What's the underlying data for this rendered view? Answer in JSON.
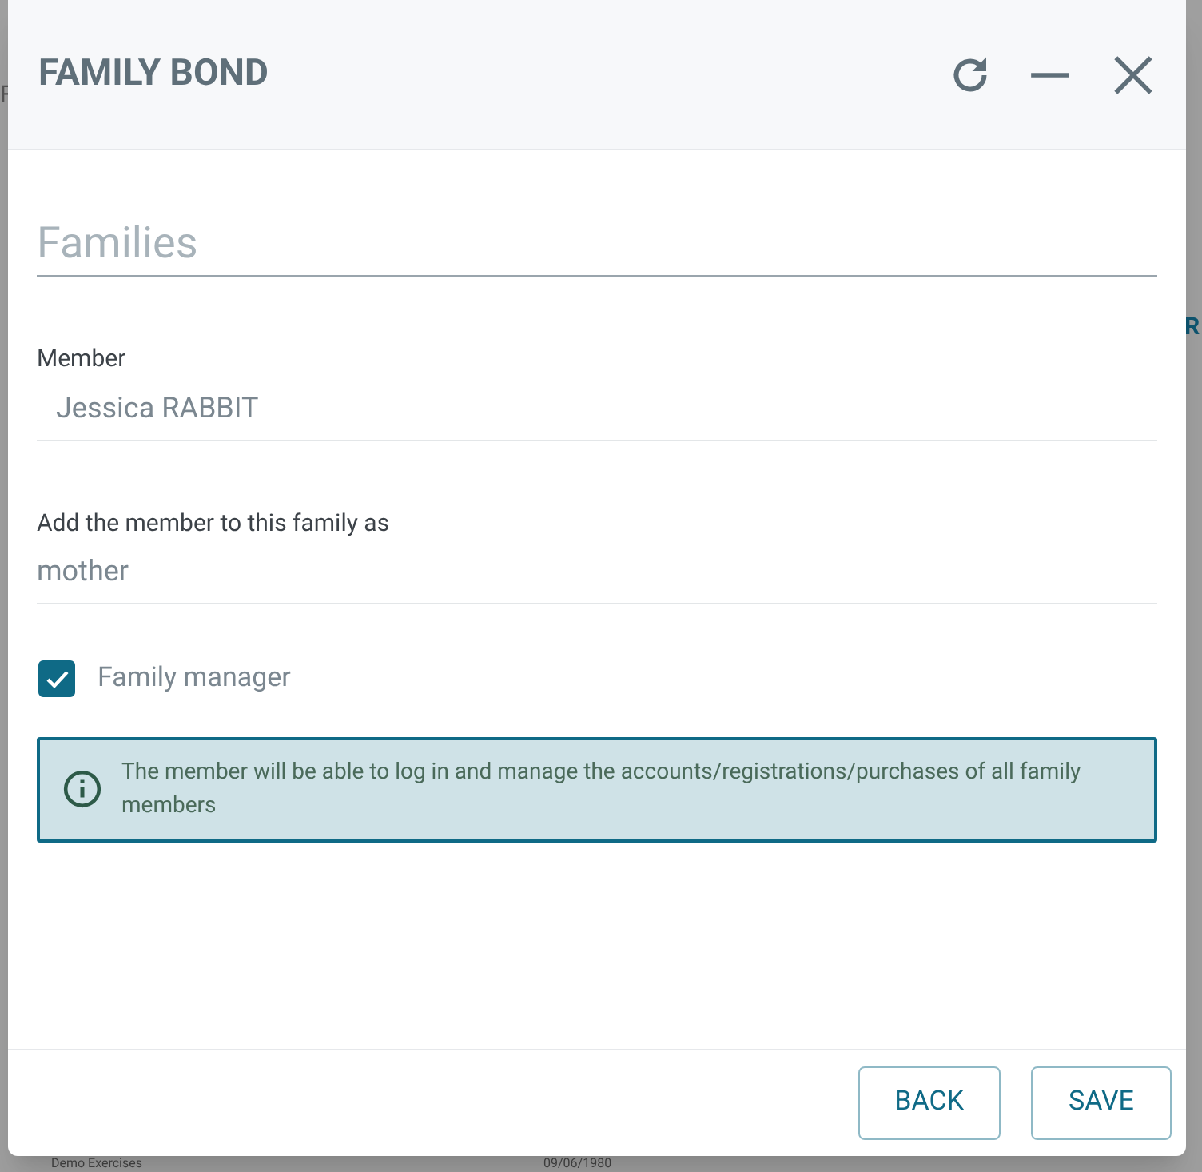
{
  "backdrop": {
    "left_text": "F",
    "right_text": "R",
    "row": [
      "Demo Exercises",
      "09/06/1980"
    ]
  },
  "dialog": {
    "title": "FAMILY BOND",
    "section_title": "Families",
    "fields": [
      {
        "kind": "input",
        "label": "Member",
        "value": "Jessica RABBIT"
      },
      {
        "kind": "text",
        "label": "Add the member to this family as",
        "value": "mother"
      }
    ],
    "manager": {
      "label": "Family manager",
      "checked": true
    },
    "info": "The member will be able to log in and manage the accounts/registrations/purchases of all family members",
    "buttons": [
      "BACK",
      "SAVE"
    ]
  }
}
